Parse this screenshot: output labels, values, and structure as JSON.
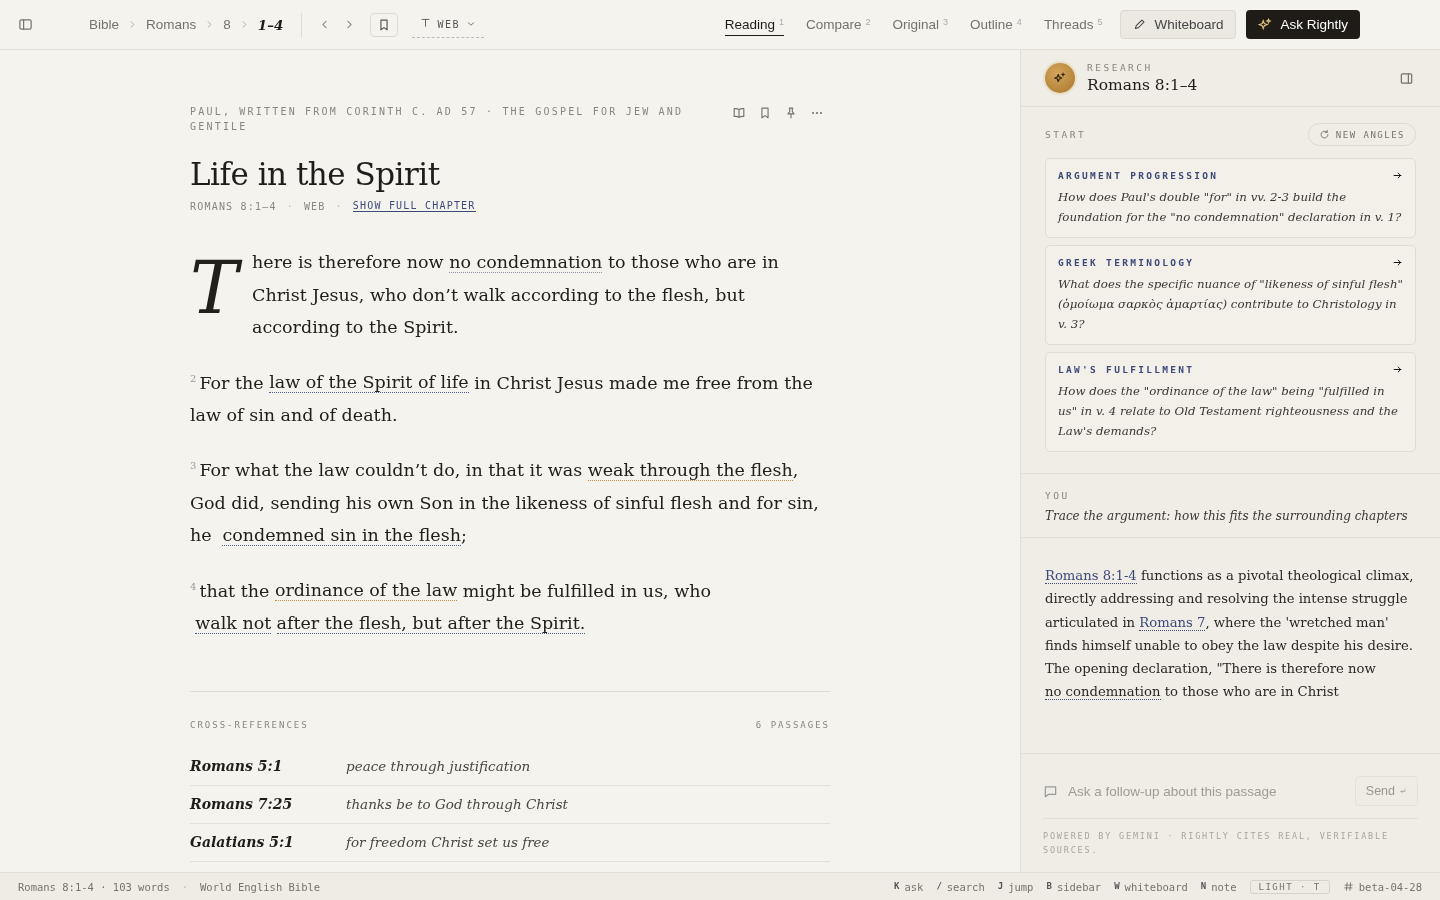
{
  "breadcrumb": [
    "Bible",
    "Romans",
    "8",
    "1–4"
  ],
  "translation": "WEB",
  "tabs": [
    {
      "label": "Reading",
      "key": "1",
      "selected": true
    },
    {
      "label": "Compare",
      "key": "2",
      "selected": false
    },
    {
      "label": "Original",
      "key": "3",
      "selected": false
    },
    {
      "label": "Outline",
      "key": "4",
      "selected": false
    },
    {
      "label": "Threads",
      "key": "5",
      "selected": false
    }
  ],
  "whiteboard_button": "Whiteboard",
  "ask_button": "Ask Rightly",
  "passage": {
    "context": "PAUL, WRITTEN FROM CORINTH C. AD 57 · THE GOSPEL FOR JEW AND GENTILE",
    "title": "Life in the Spirit",
    "reference": "ROMANS 8:1–4",
    "version": "WEB",
    "separator": "·",
    "full_chapter_link": "SHOW FULL CHAPTER",
    "verses": [
      {
        "drop_cap": "T",
        "segments": [
          {
            "kind": "plain",
            "text": "here is therefore now "
          },
          {
            "kind": "note",
            "text": "no condemnation",
            "color": "#8a8f9c"
          },
          {
            "kind": "plain",
            "text": " to those who are in Christ Jesus, who don’t walk according to the flesh, but according to the Spirit."
          }
        ]
      },
      {
        "number": "2",
        "segments": [
          {
            "kind": "plain",
            "text": "For the "
          },
          {
            "kind": "note",
            "text": "law of the Spirit of life",
            "color": "#4a5a8a"
          },
          {
            "kind": "plain",
            "text": " in Christ Jesus made me free from the law of sin and of death."
          }
        ]
      },
      {
        "number": "3",
        "segments": [
          {
            "kind": "plain",
            "text": "For what the law couldn’t do, in that it was "
          },
          {
            "kind": "note",
            "text": "weak through the flesh",
            "color": "#c0894a"
          },
          {
            "kind": "plain",
            "text": ", God did, sending his own Son in the likeness of sinful flesh and for sin, he "
          },
          {
            "kind": "note",
            "text": "condemned sin in the flesh",
            "color": "#4a5a8a"
          },
          {
            "kind": "plain",
            "text": ";"
          }
        ]
      },
      {
        "number": "4",
        "segments": [
          {
            "kind": "plain",
            "text": "that the "
          },
          {
            "kind": "note",
            "text": "ordinance of the law",
            "color": "#c0894a"
          },
          {
            "kind": "plain",
            "text": " might be fulfilled in us, who "
          },
          {
            "kind": "note",
            "text": "walk not",
            "color": "#4a5a8a"
          },
          {
            "kind": "note",
            "text": "after the flesh, but after the Spirit.",
            "color": "#4a5a8a"
          }
        ]
      }
    ]
  },
  "cross_references": {
    "heading": "CROSS-REFERENCES",
    "count": "6 PASSAGES",
    "rows": [
      {
        "reference": "Romans 5:1",
        "summary": "peace through justification"
      },
      {
        "reference": "Romans 7:25",
        "summary": "thanks be to God through Christ"
      },
      {
        "reference": "Galatians 5:1",
        "summary": "for freedom Christ set us free"
      }
    ]
  },
  "research": {
    "label": "RESEARCH",
    "title": "Romans 8:1–4",
    "start_label": "START",
    "new_angles_button": "NEW ANGLES",
    "prompts": [
      {
        "tag": "ARGUMENT PROGRESSION",
        "question": "How does Paul's double \"for\" in *vv. 2-3* build the foundation for the \"no condemnation\" declaration in *v. 1*?"
      },
      {
        "tag": "GREEK TERMINOLOGY",
        "question": "What does the specific nuance of \"likeness of sinful flesh\" (ὁμοίωμα σαρκὸς ἁμαρτίας) contribute to Christology in *v. 3*?"
      },
      {
        "tag": "LAW'S FULFILLMENT",
        "question": "How does the \"ordinance of the law\" being \"fulfilled in us\" in *v. 4* relate to Old Testament righteousness and the Law's demands?"
      }
    ],
    "you_label": "YOU",
    "user_message": "Trace the argument: how this fits the surrounding chapters",
    "answer": [
      {
        "kind": "ref",
        "text": "Romans 8:1-4"
      },
      {
        "kind": "plain",
        "text": " functions as a pivotal theological climax, directly addressing and resolving the intense struggle articulated in "
      },
      {
        "kind": "ref",
        "text": "Romans 7"
      },
      {
        "kind": "plain",
        "text": ", where the 'wretched man' finds himself unable to obey the law despite his desire. The opening declaration, \"There is therefore now "
      },
      {
        "kind": "note",
        "text": "no condemnation"
      },
      {
        "kind": "plain",
        "text": " to those who are in Christ"
      }
    ],
    "input_placeholder": "Ask a follow-up about this passage",
    "send_button": "Send",
    "footnote": "POWERED BY GEMINI · RIGHTLY CITES REAL, VERIFIABLE SOURCES."
  },
  "status_bar": {
    "separator": "·",
    "left": [
      "Romans 8:1-4 · 103 words",
      "World English Bible"
    ],
    "shortcuts": [
      {
        "key": "K",
        "label": "ask"
      },
      {
        "key": "/",
        "label": "search"
      },
      {
        "key": "J",
        "label": "jump"
      },
      {
        "key": "B",
        "label": "sidebar"
      },
      {
        "key": "W",
        "label": "whiteboard"
      },
      {
        "key": "N",
        "label": "note"
      }
    ],
    "theme": "LIGHT · T",
    "build": "beta-04-28"
  }
}
